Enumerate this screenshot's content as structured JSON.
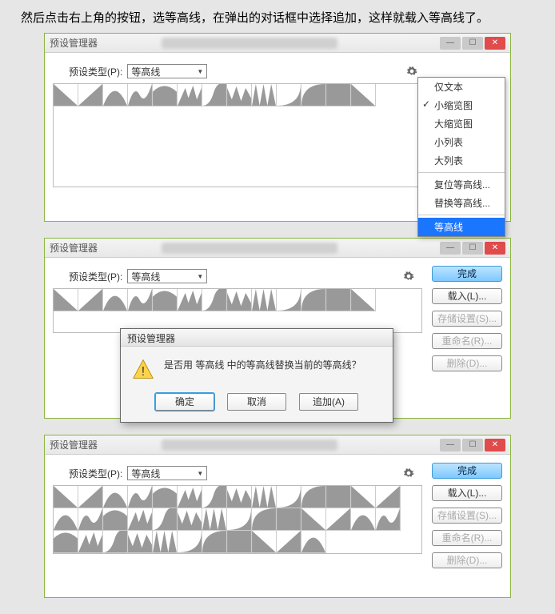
{
  "intro_text": "然后点击右上角的按钮，选等高线，在弹出的对话框中选择追加，这样就载入等高线了。",
  "window_title": "预设管理器",
  "preset_type_label": "预设类型(P):",
  "preset_type_value": "等高线",
  "menu": {
    "items": [
      {
        "label": "仅文本"
      },
      {
        "label": "小缩览图",
        "checked": true
      },
      {
        "label": "大缩览图"
      },
      {
        "label": "小列表"
      },
      {
        "label": "大列表"
      },
      {
        "label": "复位等高线..."
      },
      {
        "label": "替换等高线..."
      },
      {
        "label": "等高线",
        "selected": true
      }
    ]
  },
  "buttons": {
    "done": "完成",
    "load": "载入(L)...",
    "save": "存储设置(S)...",
    "rename": "重命名(R)...",
    "delete": "删除(D)..."
  },
  "dialog": {
    "title": "预设管理器",
    "message": "是否用 等高线 中的等高线替换当前的等高线？",
    "ok": "确定",
    "cancel": "取消",
    "append": "追加(A)"
  },
  "chart_data": null
}
